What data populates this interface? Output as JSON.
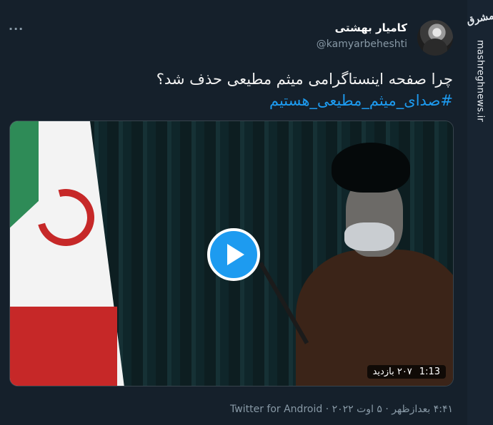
{
  "tweet": {
    "display_name": "کامیار بهشتی",
    "handle": "@kamyarbeheshti",
    "more_label": "···",
    "text": "چرا صفحه اینستاگرامی میثم مطیعی حذف شد؟",
    "hashtag": "#صدای_میثم_مطیعی_هستیم"
  },
  "video": {
    "duration": "1:13",
    "views": "۲۰۷ بازدید",
    "play_icon": "play-icon"
  },
  "meta": {
    "time": "۴:۴۱ بعدازظهر",
    "date": "۵ اوت ۲۰۲۲",
    "source": "Twitter for Android",
    "separator": "·"
  },
  "watermark": {
    "logo": "مشرق",
    "url": "mashreghnews.ir"
  },
  "colors": {
    "background": "#15202b",
    "accent": "#1d9bf0",
    "secondary_text": "#8899a6"
  }
}
